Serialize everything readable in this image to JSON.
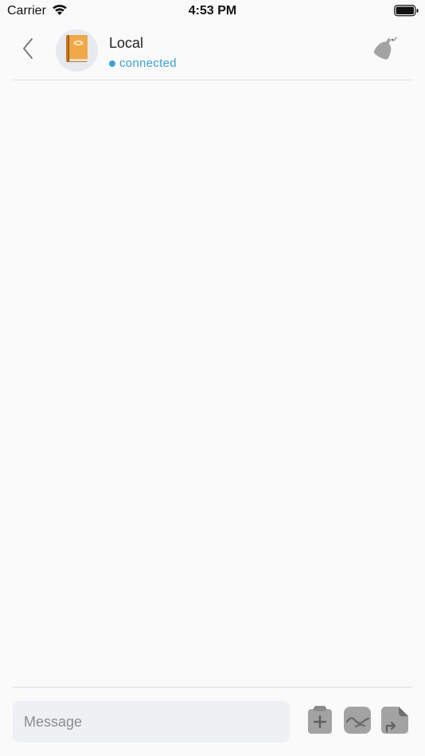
{
  "status_bar": {
    "carrier": "Carrier",
    "time": "4:53 PM",
    "icons": [
      "wifi-icon",
      "battery-icon"
    ]
  },
  "header": {
    "back_icon": "chevron-left-icon",
    "avatar_icon": "book-icon",
    "title": "Local",
    "status": "connected",
    "status_color": "#3aa0d8",
    "bell_icon": "bell-icon"
  },
  "composer": {
    "placeholder": "Message",
    "tools": [
      "add-clipboard-icon",
      "image-icon",
      "file-icon"
    ]
  },
  "colors": {
    "background": "#fafafa",
    "input_background": "#eef0f3",
    "icon_gray": "#a3a3a3",
    "accent": "#3aa0d8",
    "book_orange": "#f0a848"
  }
}
